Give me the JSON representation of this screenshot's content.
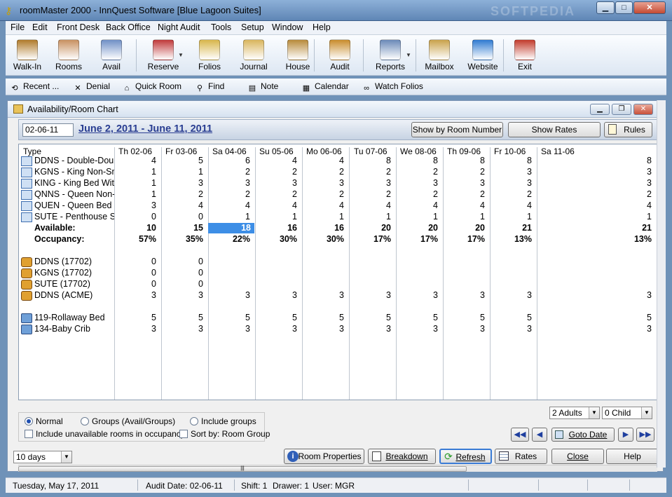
{
  "window": {
    "title": "roomMaster 2000 - InnQuest Software [Blue Lagoon Suites]",
    "watermark": "SOFTPEDIA"
  },
  "menu": [
    "File",
    "Edit",
    "Front Desk",
    "Back Office",
    "Night Audit",
    "Tools",
    "Setup",
    "Window",
    "Help"
  ],
  "toolbar": [
    {
      "label": "Walk-In",
      "icon": "suitcase-icon",
      "color": "#b07a2a"
    },
    {
      "label": "Rooms",
      "icon": "bed-icon",
      "color": "#c89060"
    },
    {
      "label": "Avail",
      "icon": "calendar-icon",
      "color": "#6f8fc6"
    },
    {
      "label": "Reserve",
      "icon": "book-icon",
      "color": "#c0393a"
    },
    {
      "label": "Folios",
      "icon": "folders-icon",
      "color": "#d8b64a"
    },
    {
      "label": "Journal",
      "icon": "scroll-icon",
      "color": "#d9b55c"
    },
    {
      "label": "House",
      "icon": "broom-icon",
      "color": "#b88a3a"
    },
    {
      "label": "Audit",
      "icon": "clock-icon",
      "color": "#c98c2c"
    },
    {
      "label": "Reports",
      "icon": "printer-icon",
      "color": "#6a89b8"
    },
    {
      "label": "Mailbox",
      "icon": "envelope-icon",
      "color": "#c9a24a"
    },
    {
      "label": "Website",
      "icon": "globe-icon",
      "color": "#2f7ad1"
    },
    {
      "label": "Exit",
      "icon": "door-icon",
      "color": "#c23b2b"
    }
  ],
  "toolbar2": [
    {
      "label": "Recent ...",
      "icon": "recent-icon"
    },
    {
      "label": "Denial",
      "icon": "x-icon"
    },
    {
      "label": "Quick Room",
      "icon": "house-icon"
    },
    {
      "label": "Find",
      "icon": "magnifier-icon"
    },
    {
      "label": "Note",
      "icon": "note-icon"
    },
    {
      "label": "Calendar",
      "icon": "calendar-small-icon"
    },
    {
      "label": "Watch Folios",
      "icon": "glasses-icon"
    }
  ],
  "child": {
    "title": "Availability/Room Chart",
    "date_input": "02-06-11",
    "date_range": "June  2, 2011 - June 11, 2011",
    "btn_show_room_number": "Show by Room Number",
    "btn_show_rates": "Show Rates",
    "btn_rules": "Rules"
  },
  "grid": {
    "type_header": "Type",
    "days": [
      "Th 02-06",
      "Fr 03-06",
      "Sa 04-06",
      "Su 05-06",
      "Mo 06-06",
      "Tu 07-06",
      "We 08-06",
      "Th 09-06",
      "Fr 10-06",
      "Sa 11-06"
    ],
    "rows": [
      {
        "label": "DDNS - Double-Double Non-Smoking",
        "kind": "room",
        "values": [
          "4",
          "5",
          "6",
          "4",
          "4",
          "8",
          "8",
          "8",
          "8",
          "8"
        ]
      },
      {
        "label": "KGNS - King Non-Smoking",
        "kind": "room",
        "values": [
          "1",
          "1",
          "2",
          "2",
          "2",
          "2",
          "2",
          "2",
          "3",
          "3"
        ]
      },
      {
        "label": "KING - King Bed With",
        "kind": "room",
        "values": [
          "1",
          "3",
          "3",
          "3",
          "3",
          "3",
          "3",
          "3",
          "3",
          "3"
        ]
      },
      {
        "label": "QNNS - Queen Non-Smoking",
        "kind": "room",
        "values": [
          "1",
          "2",
          "2",
          "2",
          "2",
          "2",
          "2",
          "2",
          "2",
          "2"
        ]
      },
      {
        "label": "QUEN - Queen Bed",
        "kind": "room",
        "values": [
          "3",
          "4",
          "4",
          "4",
          "4",
          "4",
          "4",
          "4",
          "4",
          "4"
        ]
      },
      {
        "label": "SUTE - Penthouse Suite",
        "kind": "room",
        "values": [
          "0",
          "0",
          "1",
          "1",
          "1",
          "1",
          "1",
          "1",
          "1",
          "1"
        ]
      },
      {
        "label": "Available:",
        "kind": "bold",
        "values": [
          "10",
          "15",
          "18",
          "16",
          "16",
          "20",
          "20",
          "20",
          "21",
          "21"
        ]
      },
      {
        "label": "Occupancy:",
        "kind": "bold",
        "values": [
          "57%",
          "35%",
          "22%",
          "30%",
          "30%",
          "17%",
          "17%",
          "17%",
          "13%",
          "13%"
        ]
      },
      {
        "label": "",
        "kind": "blank",
        "values": [
          "",
          "",
          "",
          "",
          "",
          "",
          "",
          "",
          "",
          ""
        ]
      },
      {
        "label": "DDNS (17702)",
        "kind": "group",
        "values": [
          "0",
          "0",
          "",
          "",
          "",
          "",
          "",
          "",
          "",
          ""
        ]
      },
      {
        "label": "KGNS (17702)",
        "kind": "group",
        "values": [
          "0",
          "0",
          "",
          "",
          "",
          "",
          "",
          "",
          "",
          ""
        ]
      },
      {
        "label": "SUTE (17702)",
        "kind": "group",
        "values": [
          "0",
          "0",
          "",
          "",
          "",
          "",
          "",
          "",
          "",
          ""
        ]
      },
      {
        "label": "DDNS (ACME)",
        "kind": "group",
        "values": [
          "3",
          "3",
          "3",
          "3",
          "3",
          "3",
          "3",
          "3",
          "3",
          "3"
        ]
      },
      {
        "label": "",
        "kind": "blank",
        "values": [
          "",
          "",
          "",
          "",
          "",
          "",
          "",
          "",
          "",
          ""
        ]
      },
      {
        "label": "119-Rollaway Bed",
        "kind": "item",
        "values": [
          "5",
          "5",
          "5",
          "5",
          "5",
          "5",
          "5",
          "5",
          "5",
          "5"
        ]
      },
      {
        "label": "134-Baby Crib",
        "kind": "item",
        "values": [
          "3",
          "3",
          "3",
          "3",
          "3",
          "3",
          "3",
          "3",
          "3",
          "3"
        ]
      }
    ]
  },
  "options": {
    "normal": "Normal",
    "groups": "Groups (Avail/Groups)",
    "include_groups": "Include groups",
    "include_unavailable": "Include unavailable rooms in occupancy",
    "sort_by": "Sort by: Room Group"
  },
  "adults_select": "2 Adults",
  "child_select": "0 Child",
  "goto_date": "Goto Date",
  "days_select": "10 days",
  "bottom_buttons": {
    "room_properties": "Room Properties",
    "breakdown": "Breakdown",
    "refresh": "Refresh",
    "rates": "Rates",
    "close": "Close",
    "help": "Help"
  },
  "status": {
    "date": "Tuesday, May 17, 2011",
    "audit": "Audit Date: 02-06-11",
    "shift": "Shift: 1",
    "drawer": "Drawer: 1",
    "user": "User: MGR"
  }
}
